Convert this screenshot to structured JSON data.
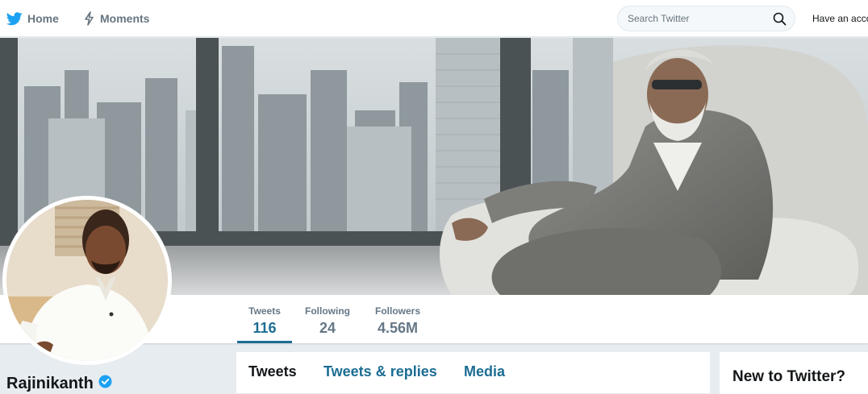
{
  "topnav": {
    "home_label": "Home",
    "moments_label": "Moments",
    "search_placeholder": "Search Twitter",
    "account_text": "Have an acco"
  },
  "profile": {
    "name": "Rajinikanth"
  },
  "stats": [
    {
      "label": "Tweets",
      "value": "116"
    },
    {
      "label": "Following",
      "value": "24"
    },
    {
      "label": "Followers",
      "value": "4.56M"
    }
  ],
  "timeline_tabs": [
    {
      "label": "Tweets"
    },
    {
      "label": "Tweets & replies"
    },
    {
      "label": "Media"
    }
  ],
  "sidebar": {
    "new_title": "New to Twitter?"
  },
  "colors": {
    "brand": "#1da1f2",
    "accent": "#1c6d93",
    "muted": "#657786",
    "verified": "#1da1f2"
  },
  "icons": [
    "twitter-bird-icon",
    "lightning-icon",
    "search-icon",
    "verified-badge-icon"
  ]
}
